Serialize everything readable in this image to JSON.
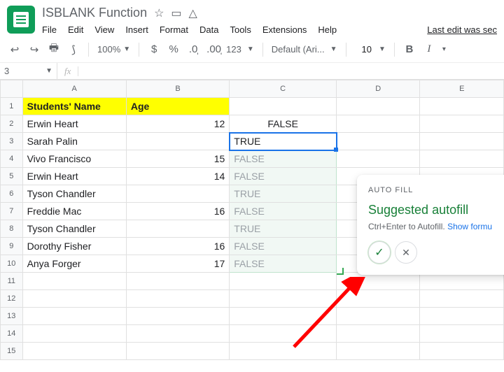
{
  "title": "ISBLANK Function",
  "menu": {
    "file": "File",
    "edit": "Edit",
    "view": "View",
    "insert": "Insert",
    "format": "Format",
    "data": "Data",
    "tools": "Tools",
    "extensions": "Extensions",
    "help": "Help",
    "last": "Last edit was sec"
  },
  "toolbar": {
    "zoom": "100%",
    "fmt123": "123",
    "font": "Default (Ari...",
    "size": "10"
  },
  "fbar": {
    "name": "3",
    "fx": "fx"
  },
  "cols": [
    "A",
    "B",
    "C",
    "D",
    "E"
  ],
  "rows": [
    "1",
    "2",
    "3",
    "4",
    "5",
    "6",
    "7",
    "8",
    "9",
    "10",
    "11",
    "12",
    "13",
    "14",
    "15"
  ],
  "header": {
    "a": "Students' Name",
    "b": "Age"
  },
  "data": [
    {
      "a": "Erwin Heart",
      "b": "12",
      "c": "FALSE"
    },
    {
      "a": "Sarah Palin",
      "b": "",
      "c": "TRUE"
    },
    {
      "a": "Vivo Francisco",
      "b": "15",
      "c": "FALSE"
    },
    {
      "a": "Erwin Heart",
      "b": "14",
      "c": "FALSE"
    },
    {
      "a": "Tyson Chandler",
      "b": "",
      "c": "TRUE"
    },
    {
      "a": "Freddie Mac",
      "b": "16",
      "c": "FALSE"
    },
    {
      "a": "Tyson Chandler",
      "b": "",
      "c": "TRUE"
    },
    {
      "a": "Dorothy Fisher",
      "b": "16",
      "c": "FALSE"
    },
    {
      "a": "Anya Forger",
      "b": "17",
      "c": "FALSE"
    }
  ],
  "popup": {
    "label": "AUTO FILL",
    "title": "Suggested autofill",
    "hint": "Ctrl+Enter to Autofill. ",
    "link": "Show formu"
  }
}
